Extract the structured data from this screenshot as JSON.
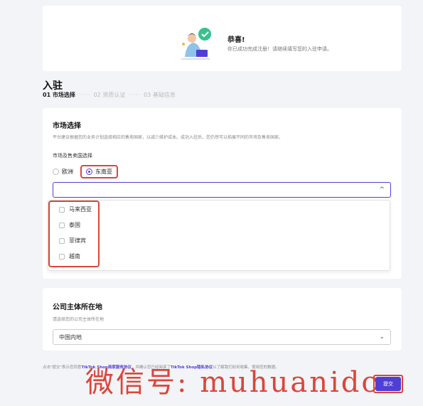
{
  "banner": {
    "title": "恭喜!",
    "subtitle": "你已成功完成注册！请继续填写您的入驻申请。"
  },
  "page": {
    "title": "入驻",
    "steps": [
      {
        "label": "01 市场选择",
        "active": true
      },
      {
        "label": "02 资质认证",
        "active": false
      },
      {
        "label": "03 基础信息",
        "active": false
      }
    ],
    "step_separator": "·····"
  },
  "market": {
    "title": "市场选择",
    "description": "平台建议根据您的业务计划选择相应的售卖国家，以减少维护成本。成功入驻后，您仍然可以拓展不同的市场及售卖国家。",
    "field_label": "市场及售卖国选择",
    "radio_options": [
      {
        "label": "欧洲",
        "selected": false
      },
      {
        "label": "东南亚",
        "selected": true
      }
    ],
    "select_value": "",
    "select_chevron": "^",
    "dropdown_options": [
      "马来西亚",
      "泰国",
      "菲律宾",
      "越南"
    ]
  },
  "company": {
    "title": "公司主体所在地",
    "description": "请选择您的公司主体所在地",
    "select_value": "中国内地",
    "select_chevron": "⌄"
  },
  "footer": {
    "note_prefix": "点击\"提交\"表示您同意",
    "link1": "TikTok Shop商家服务协议",
    "note_mid": "，并确认您已经阅读了",
    "link2": "TikTok Shop隐私协议",
    "note_suffix": "以了解我们如何收集、使用您的数据。",
    "submit_label": "提交"
  },
  "watermark": "微信号: muhuanidc",
  "colors": {
    "accent": "#4f3fd6",
    "highlight": "#d9473a"
  }
}
